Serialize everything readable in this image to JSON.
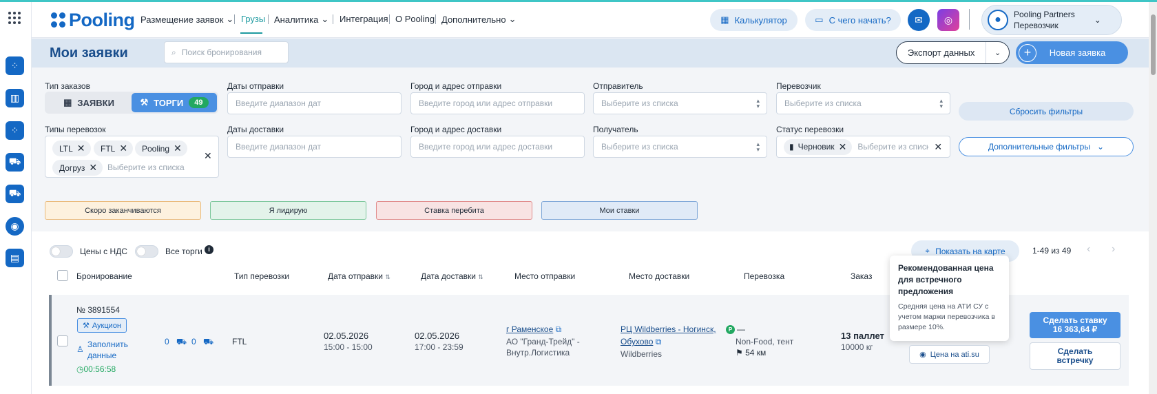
{
  "header": {
    "logo_text": "Pooling",
    "nav": [
      {
        "label": "Размещение заявок",
        "has_dropdown": true
      },
      {
        "label": "Грузы",
        "active": true
      },
      {
        "label": "Аналитика",
        "has_dropdown": true
      },
      {
        "label": "Интеграция"
      },
      {
        "label": "О Pooling"
      },
      {
        "label": "Дополнительно",
        "has_dropdown": true
      }
    ],
    "calculator_label": "Калькулятор",
    "start_label": "С чего начать?",
    "user": {
      "name": "Pooling Partners",
      "role": "Перевозчик"
    }
  },
  "titlebar": {
    "title": "Мои заявки",
    "search_placeholder": "Поиск бронирования",
    "export_label": "Экспорт данных",
    "new_label": "Новая заявка"
  },
  "filters": {
    "order_type_label": "Тип заказов",
    "order_type_options": {
      "requests": "ЗАЯВКИ",
      "auctions": "ТОРГИ",
      "auctions_count": "49"
    },
    "dispatch_dates_label": "Даты отправки",
    "dispatch_dates_placeholder": "Введите диапазон дат",
    "origin_label": "Город и адрес отправки",
    "origin_placeholder": "Введите город или адрес отправки",
    "sender_label": "Отправитель",
    "sender_placeholder": "Выберите из списка",
    "carrier_label": "Перевозчик",
    "carrier_placeholder": "Выберите из списка",
    "reset_label": "Сбросить фильтры",
    "transport_types_label": "Типы перевозок",
    "transport_tags": [
      "LTL",
      "FTL",
      "Pooling",
      "Догруз"
    ],
    "transport_placeholder": "Выберите из списка",
    "delivery_dates_label": "Даты доставки",
    "delivery_dates_placeholder": "Введите диапазон дат",
    "destination_label": "Город и адрес доставки",
    "destination_placeholder": "Введите город или адрес доставки",
    "receiver_label": "Получатель",
    "receiver_placeholder": "Выберите из списка",
    "status_label": "Статус перевозки",
    "status_tag": "Черновик",
    "status_placeholder": "Выберите из списка",
    "more_filters_label": "Дополнительные фильтры"
  },
  "quick_filters": [
    {
      "label": "Скоро заканчиваются",
      "bg": "#fdf1de",
      "border": "#e9b97a"
    },
    {
      "label": "Я лидирую",
      "bg": "#e3f3ea",
      "border": "#7cc79b"
    },
    {
      "label": "Ставка перебита",
      "bg": "#f8e3e3",
      "border": "#e08a8a"
    },
    {
      "label": "Мои ставки",
      "bg": "#e0eaf7",
      "border": "#7fa7d8"
    }
  ],
  "table_controls": {
    "vat_label": "Цены с НДС",
    "all_auctions_label": "Все торги",
    "map_label": "Показать на карте",
    "pagination": "1-49 из 49"
  },
  "columns": [
    "Бронирование",
    "Тип перевозки",
    "Дата отправки",
    "Дата доставки",
    "Место отправки",
    "Место доставки",
    "Перевозка",
    "Заказ"
  ],
  "row": {
    "number": "№ 3891554",
    "auction_label": "Аукцион",
    "fill_data_label": "Заполнить данные",
    "timer": "00:56:58",
    "count_a": "0",
    "count_b": "0",
    "transport_type": "FTL",
    "dispatch_date": "02.05.2026",
    "dispatch_time": "15:00 - 15:00",
    "delivery_date": "02.05.2026",
    "delivery_time": "17:00 - 23:59",
    "origin_city": "г Раменское",
    "origin_company": "АО \"Гранд-Трейд\" - Внутр.Логистика",
    "destination_line1": "РЦ Wildberries - Ногинск,",
    "destination_line2": "Обухово",
    "destination_company": "Wildberries",
    "transport_dash": "—",
    "cargo_type": "Non-Food, тент",
    "distance": "54 км",
    "pallets": "13 паллет",
    "weight": "10000 кг",
    "ati_label": "Цена на ati.su",
    "bid_label": "Сделать ставку",
    "bid_price": "16 363,64 ₽",
    "counter_label": "Сделать встречку"
  },
  "tooltip": {
    "title": "Рекомендованная цена для встречного предложения",
    "body": "Средняя цена на АТИ СУ с учетом маржи перевозчика в размере 10%."
  }
}
